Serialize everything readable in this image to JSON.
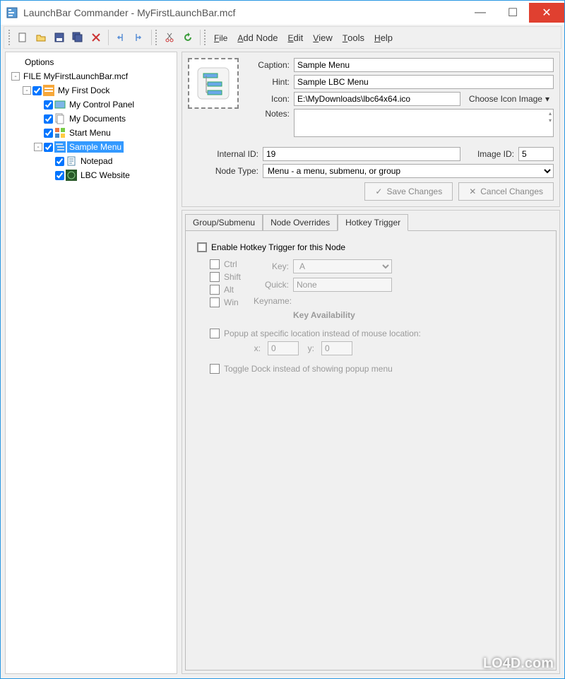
{
  "window": {
    "title": "LaunchBar Commander - MyFirstLaunchBar.mcf"
  },
  "menu": {
    "file": "File",
    "addNode": "Add Node",
    "edit": "Edit",
    "view": "View",
    "tools": "Tools",
    "help": "Help"
  },
  "tree": {
    "root": "Options",
    "file": "FILE MyFirstLaunchBar.mcf",
    "dock": "My First Dock",
    "items": [
      "My Control Panel",
      "My Documents",
      "Start Menu",
      "Sample Menu"
    ],
    "children": [
      "Notepad",
      "LBC Website"
    ]
  },
  "props": {
    "captionLabel": "Caption:",
    "caption": "Sample Menu",
    "hintLabel": "Hint:",
    "hint": "Sample LBC Menu",
    "iconLabel": "Icon:",
    "icon": "E:\\MyDownloads\\lbc64x64.ico",
    "chooseIcon": "Choose Icon Image",
    "notesLabel": "Notes:",
    "internalIdLabel": "Internal ID:",
    "internalId": "19",
    "imageIdLabel": "Image ID:",
    "imageId": "5",
    "nodeTypeLabel": "Node Type:",
    "nodeType": "Menu - a menu, submenu, or group",
    "save": "Save Changes",
    "cancel": "Cancel Changes"
  },
  "tabs": {
    "group": "Group/Submenu",
    "overrides": "Node Overrides",
    "hotkey": "Hotkey Trigger"
  },
  "hotkey": {
    "enable": "Enable Hotkey Trigger for this Node",
    "ctrl": "Ctrl",
    "shift": "Shift",
    "alt": "Alt",
    "win": "Win",
    "keyLabel": "Key:",
    "keyValue": "A",
    "quickLabel": "Quick:",
    "quickValue": "None",
    "keynameLabel": "Keyname:",
    "availability": "Key Availability",
    "popup": "Popup at specific location instead of mouse location:",
    "xLabel": "x:",
    "xValue": "0",
    "yLabel": "y:",
    "yValue": "0",
    "toggle": "Toggle Dock instead of showing popup menu"
  },
  "watermark": "LO4D.com"
}
